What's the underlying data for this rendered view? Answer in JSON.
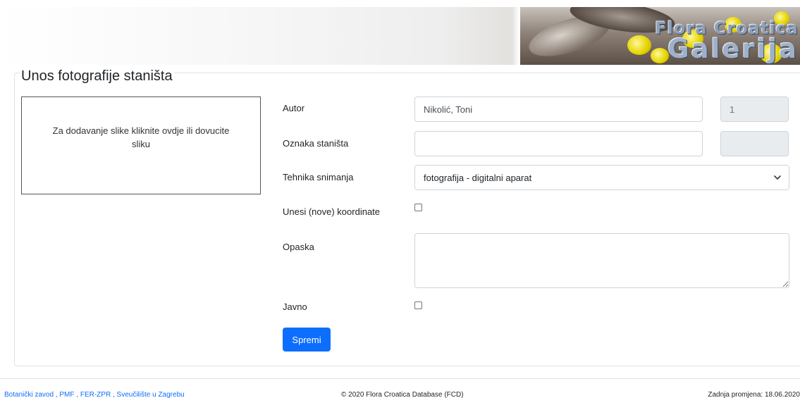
{
  "header": {
    "logo_line1": "Flora Croatica",
    "logo_line2": "Galerija"
  },
  "form": {
    "legend": "Unos fotografije staništa",
    "dropzone_text": "Za dodavanje slike kliknite ovdje ili dovucite sliku",
    "fields": {
      "autor_label": "Autor",
      "autor_value": "Nikolić, Toni",
      "autor_id": "1",
      "oznaka_label": "Oznaka staništa",
      "oznaka_value": "",
      "oznaka_id": "",
      "tehnika_label": "Tehnika snimanja",
      "tehnika_value": "fotografija - digitalni aparat",
      "koordinate_label": "Unesi (nove) koordinate",
      "koordinate_checked": false,
      "opaska_label": "Opaska",
      "opaska_value": "",
      "javno_label": "Javno",
      "javno_checked": false
    },
    "save_label": "Spremi"
  },
  "footer": {
    "links": [
      "Botanički zavod",
      "PMF",
      "FER-ZPR",
      "Sveučilište u Zagrebu"
    ],
    "copyright": "© 2020 Flora Croatica Database (FCD)",
    "last_change": "Zadnja promjena: 18.06.2020"
  },
  "colors": {
    "primary": "#0d6efd",
    "border": "#ced4da",
    "readonly_bg": "#e9ecef"
  }
}
